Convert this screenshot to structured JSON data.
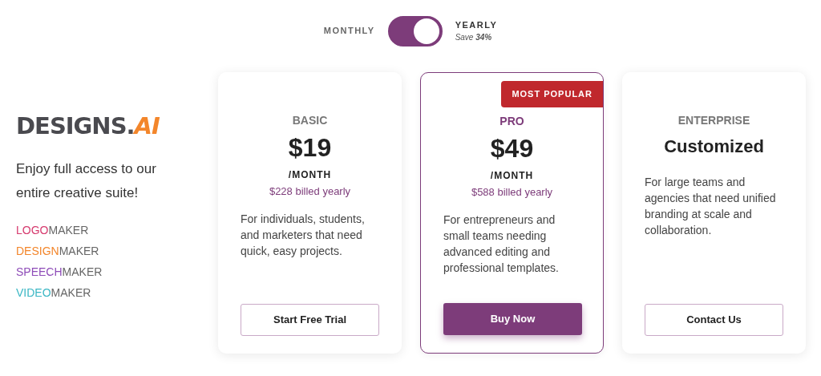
{
  "billing": {
    "options": [
      {
        "label": "MONTHLY",
        "selected": false
      },
      {
        "label": "YEARLY",
        "selected": true
      }
    ],
    "savings": "Save **34%**"
  },
  "brand": {
    "logo_main": "DESIGNS.",
    "logo_accent": "AI",
    "tagline": "Enjoy full access to our entire creative suite!",
    "products": [
      {
        "prefix": "LOGO",
        "suffix": "MAKER",
        "color": "#d63a6e"
      },
      {
        "prefix": "DESIGN",
        "suffix": "MAKER",
        "color": "#f3862b"
      },
      {
        "prefix": "SPEECH",
        "suffix": "MAKER",
        "color": "#8e4cb8"
      },
      {
        "prefix": "VIDEO",
        "suffix": "MAKER",
        "color": "#3bb7c4"
      }
    ]
  },
  "plans": [
    {
      "name": "BASIC",
      "price": "$19",
      "period": "/MONTH",
      "billed": "$228 billed yearly",
      "description": "For individuals, students, and marketers that need quick, easy projects.",
      "button": "Start Free Trial",
      "featured": false
    },
    {
      "name": "PRO",
      "price": "$49",
      "period": "/MONTH",
      "billed": "$588 billed yearly",
      "description": "For entrepreneurs and small teams needing advanced editing and professional templates.",
      "button": "Buy Now",
      "featured": true,
      "badge": "MOST POPULAR"
    },
    {
      "name": "ENTERPRISE",
      "price": "Customized",
      "description": "For large teams and agencies that need unified branding at scale and collaboration.",
      "button": "Contact Us",
      "featured": false
    }
  ]
}
